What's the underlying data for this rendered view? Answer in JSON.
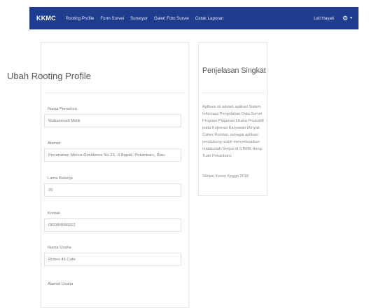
{
  "navbar": {
    "brand": "KKMC",
    "links": [
      "Rooting Profile",
      "Form Survei",
      "Surveyor",
      "Galeri Foto Survei",
      "Cetak Laporan"
    ],
    "user": "Leli Hayati",
    "bg_color": "#1e3d8f",
    "settings_icon": "gear-icon",
    "dropdown_icon": "caret-down-icon"
  },
  "form": {
    "title": "Ubah Rooting Profile",
    "fields": [
      {
        "label": "Nama Pemohon",
        "value": "Muhammad Malik"
      },
      {
        "label": "Alamat",
        "value": "Perumahan Mecca Residence No.23, Jl.Bupati, Pekanbaru, Riau"
      },
      {
        "label": "Lama Bekerja",
        "value": "20"
      },
      {
        "label": "Kontak",
        "value": "082384556212"
      },
      {
        "label": "Nama Usaha",
        "value": "Riders 46 Cafe"
      },
      {
        "label": "Alamat Usaha",
        "value": ""
      }
    ]
  },
  "info": {
    "title": "Penjelasan Singkat",
    "description": "Aplikasi ini adalah aplikasi Sistem Informasi Pengolahan Data Survei Program Pinjaman Usaha Produktif pada Koperasi Karyawan Minyak Caltex Rumbai, sebagai aplikasi pendukung untuk menyelesaikan matakuliah Skripsi di STMIK Hang Tuah Pekanbaru.",
    "footer": "Skripsi Keven Keggn 2018"
  }
}
